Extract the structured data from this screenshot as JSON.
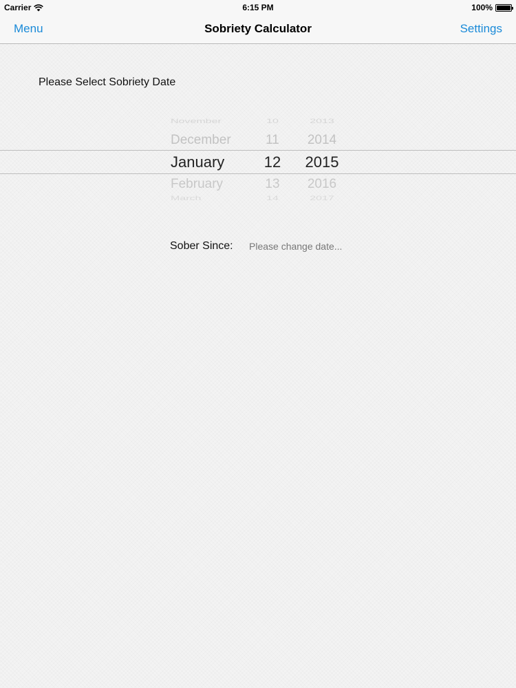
{
  "status_bar": {
    "carrier": "Carrier",
    "time": "6:15 PM",
    "battery": "100%"
  },
  "nav": {
    "left_label": "Menu",
    "title": "Sobriety Calculator",
    "right_label": "Settings",
    "accent_color": "#1a8ad8"
  },
  "prompt": "Please Select Sobriety Date",
  "picker": {
    "months": [
      "November",
      "December",
      "January",
      "February",
      "March"
    ],
    "days": [
      "10",
      "11",
      "12",
      "13",
      "14"
    ],
    "years": [
      "2013",
      "2014",
      "2015",
      "2016",
      "2017"
    ],
    "selected": {
      "month": "January",
      "day": "12",
      "year": "2015"
    }
  },
  "sober_since": {
    "label": "Sober Since:",
    "placeholder": "Please change date..."
  }
}
